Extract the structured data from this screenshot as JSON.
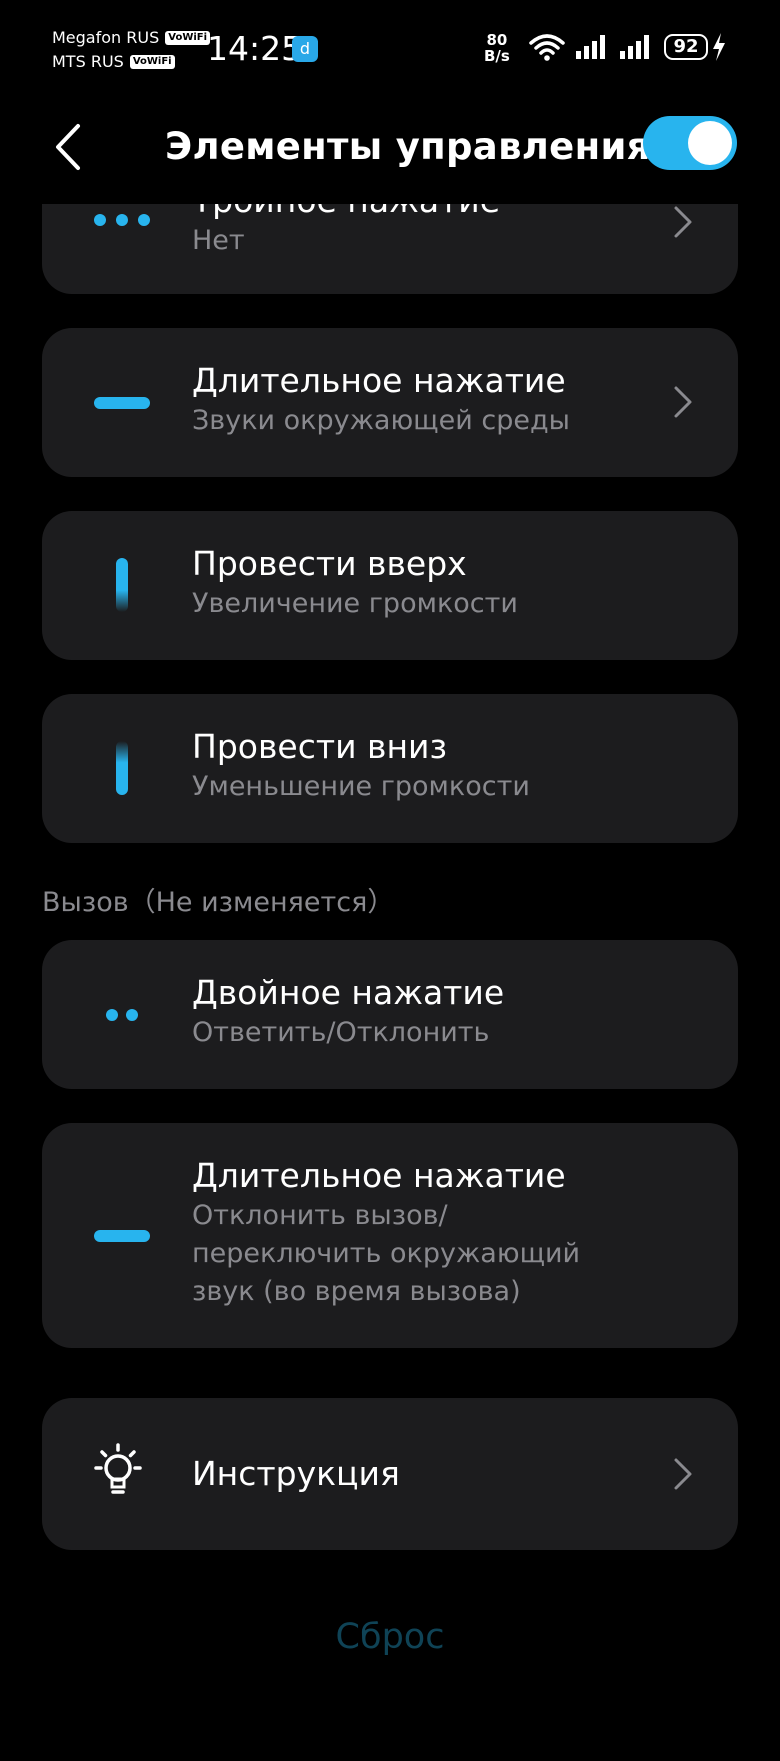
{
  "status_bar": {
    "carrier1": "Megafon RUS",
    "carrier2": "MTS RUS",
    "vowifi": "VoWiFi",
    "time": "14:25",
    "app_badge": "d",
    "net_speed_value": "80",
    "net_speed_unit": "B/s",
    "battery": "92"
  },
  "header": {
    "title": "Элементы управления",
    "toggle_on": true
  },
  "section_music": {
    "rows": [
      {
        "title": "Тройное нажатие",
        "subtitle": "Нет",
        "icon": "three-dots-icon"
      },
      {
        "title": "Длительное нажатие",
        "subtitle": "Звуки окружающей среды",
        "icon": "long-press-bar-icon"
      },
      {
        "title": "Провести вверх",
        "subtitle": "Увеличение громкости",
        "icon": "swipe-up-icon"
      },
      {
        "title": "Провести вниз",
        "subtitle": "Уменьшение громкости",
        "icon": "swipe-down-icon"
      }
    ]
  },
  "section_call": {
    "label": "Вызов（Не изменяется）",
    "rows": [
      {
        "title": "Двойное нажатие",
        "subtitle": "Ответить/Отклонить",
        "icon": "two-dots-icon"
      },
      {
        "title": "Длительное нажатие",
        "subtitle_lines": [
          "Отклонить вызов/",
          "переключить окружающий",
          "звук (во время вызова)"
        ],
        "icon": "long-press-bar-icon"
      }
    ]
  },
  "instructions": {
    "label": "Инструкция",
    "icon": "lightbulb-icon"
  },
  "reset": {
    "label": "Сброс"
  },
  "colors": {
    "accent": "#28b4ee",
    "card": "#1c1c1e",
    "secondary_text": "#8a8a8f",
    "reset_text": "#0f4356"
  }
}
